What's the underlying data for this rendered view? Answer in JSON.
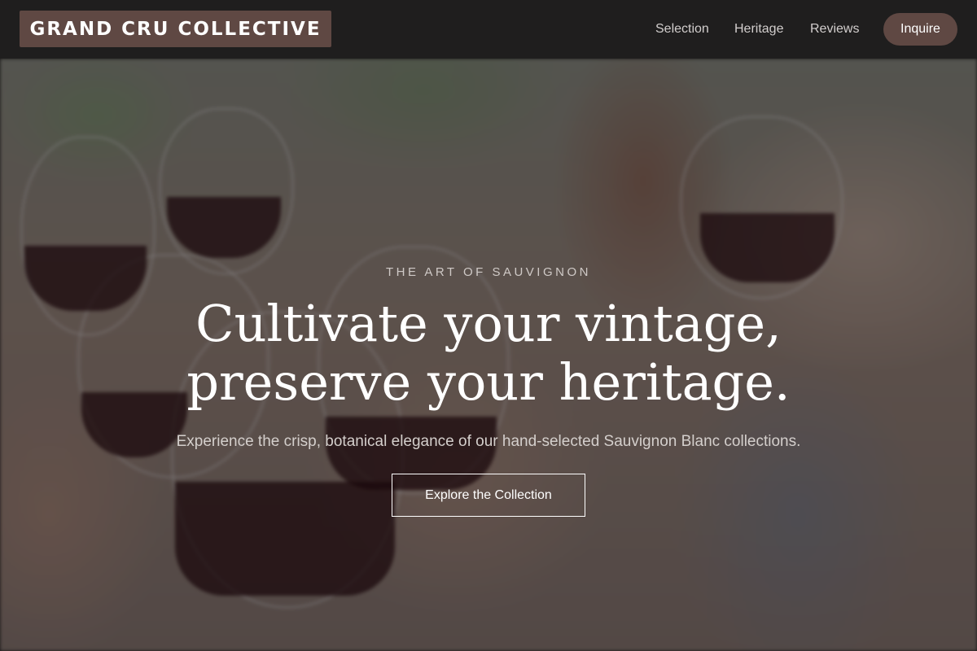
{
  "brand": {
    "name": "GRAND CRU COLLECTIVE"
  },
  "nav": {
    "links": [
      {
        "label": "Selection"
      },
      {
        "label": "Heritage"
      },
      {
        "label": "Reviews"
      }
    ],
    "cta_label": "Inquire"
  },
  "hero": {
    "eyebrow": "THE ART OF SAUVIGNON",
    "headline_line1": "Cultivate your vintage,",
    "headline_line2": "preserve your heritage.",
    "subheadline": "Experience the crisp, botanical elegance of our hand-selected Sauvignon Blanc collections.",
    "button_label": "Explore the Collection"
  },
  "colors": {
    "nav_background": "#1f1e1e",
    "brand_accent": "#5f4843",
    "text_light": "#ffffff"
  }
}
